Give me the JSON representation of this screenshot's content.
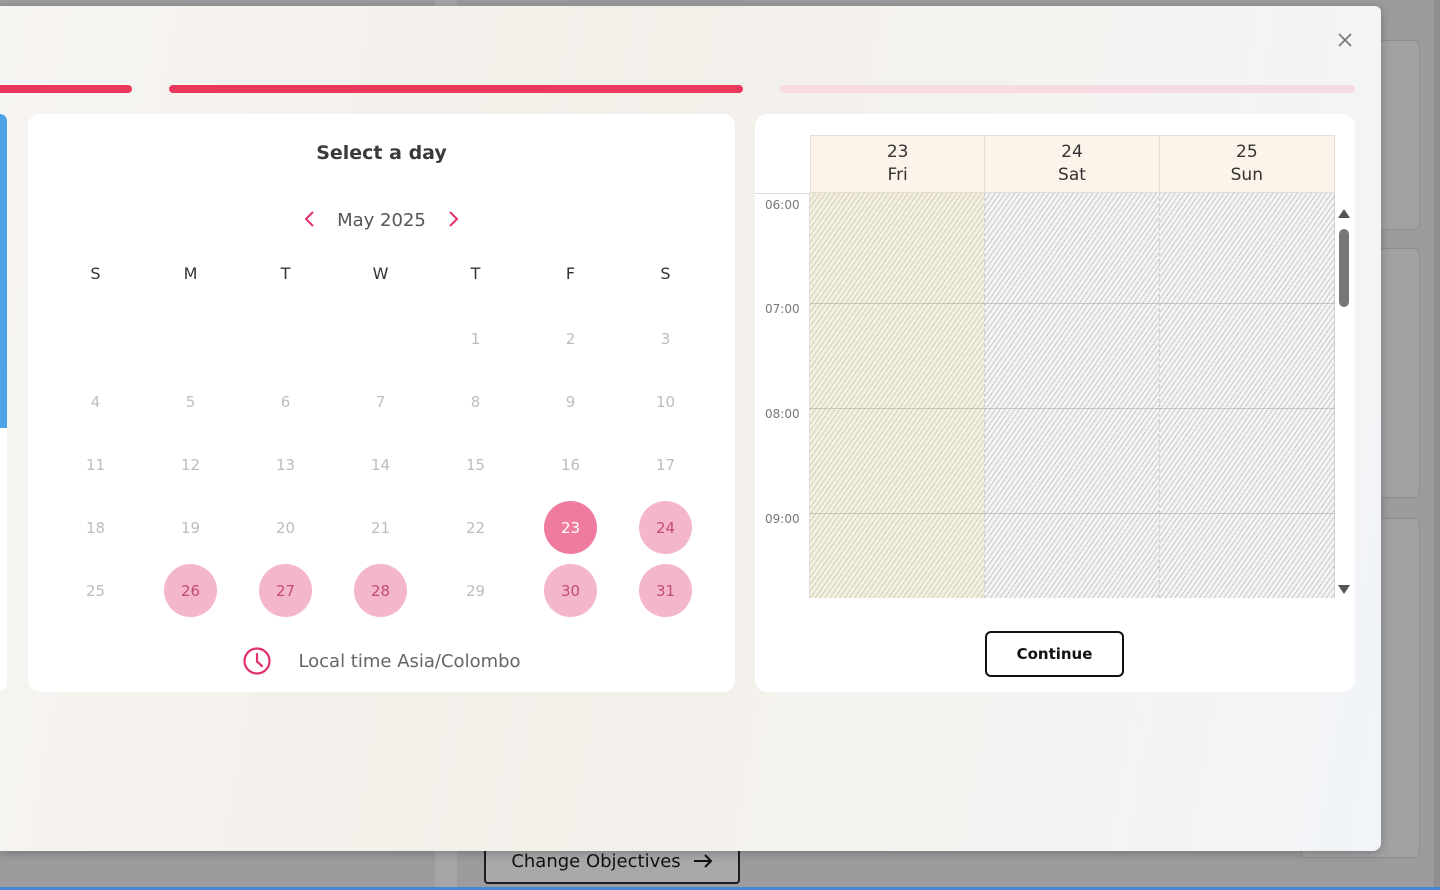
{
  "background": {
    "change_objectives_label": "Change Objectives",
    "arrow_icon": "arrow-right-icon"
  },
  "modal": {
    "close_icon": "close-icon",
    "progress": {
      "steps_total": 3,
      "steps_completed": 2,
      "active_color": "#e8385b",
      "inactive_color": "#f7dbe2"
    }
  },
  "calendar": {
    "title": "Select a day",
    "month_label": "May 2025",
    "prev_icon": "chevron-left-icon",
    "next_icon": "chevron-right-icon",
    "weekdays": [
      "S",
      "M",
      "T",
      "W",
      "T",
      "F",
      "S"
    ],
    "days": [
      {
        "label": "",
        "state": "empty"
      },
      {
        "label": "",
        "state": "empty"
      },
      {
        "label": "",
        "state": "empty"
      },
      {
        "label": "",
        "state": "empty"
      },
      {
        "label": "1",
        "state": "disabled"
      },
      {
        "label": "2",
        "state": "disabled"
      },
      {
        "label": "3",
        "state": "disabled"
      },
      {
        "label": "4",
        "state": "disabled"
      },
      {
        "label": "5",
        "state": "disabled"
      },
      {
        "label": "6",
        "state": "disabled"
      },
      {
        "label": "7",
        "state": "disabled"
      },
      {
        "label": "8",
        "state": "disabled"
      },
      {
        "label": "9",
        "state": "disabled"
      },
      {
        "label": "10",
        "state": "disabled"
      },
      {
        "label": "11",
        "state": "disabled"
      },
      {
        "label": "12",
        "state": "disabled"
      },
      {
        "label": "13",
        "state": "disabled"
      },
      {
        "label": "14",
        "state": "disabled"
      },
      {
        "label": "15",
        "state": "disabled"
      },
      {
        "label": "16",
        "state": "disabled"
      },
      {
        "label": "17",
        "state": "disabled"
      },
      {
        "label": "18",
        "state": "disabled"
      },
      {
        "label": "19",
        "state": "disabled"
      },
      {
        "label": "20",
        "state": "disabled"
      },
      {
        "label": "21",
        "state": "disabled"
      },
      {
        "label": "22",
        "state": "disabled"
      },
      {
        "label": "23",
        "state": "selected"
      },
      {
        "label": "24",
        "state": "available"
      },
      {
        "label": "25",
        "state": "disabled"
      },
      {
        "label": "26",
        "state": "available"
      },
      {
        "label": "27",
        "state": "available"
      },
      {
        "label": "28",
        "state": "available"
      },
      {
        "label": "29",
        "state": "disabled"
      },
      {
        "label": "30",
        "state": "available"
      },
      {
        "label": "31",
        "state": "available"
      }
    ],
    "timezone_icon": "clock-icon",
    "timezone_text": "Local time Asia/Colombo",
    "colors": {
      "accent": "#e0316a",
      "available": "#f4b6cb",
      "selected": "#ef7c9f"
    }
  },
  "schedule": {
    "columns": [
      {
        "day": "23",
        "weekday": "Fri"
      },
      {
        "day": "24",
        "weekday": "Sat"
      },
      {
        "day": "25",
        "weekday": "Sun"
      }
    ],
    "times": [
      "06:00",
      "07:00",
      "08:00",
      "09:00"
    ],
    "continue_label": "Continue",
    "scroll_up_icon": "scroll-up-arrow-icon",
    "scroll_down_icon": "scroll-down-arrow-icon"
  }
}
